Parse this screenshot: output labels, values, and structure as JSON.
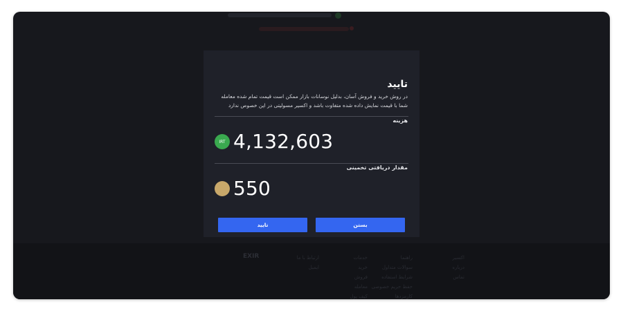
{
  "dialog": {
    "title": "تایید",
    "description": "در روش خرید و فروش آسان، بدلیل نوسانات بازار ممکن است قیمت تمام شده معامله شما با قیمت نمایش داده شده متفاوت باشد و اکسیر مسولیتی در این خصوص ندارد",
    "cost_label": "هزینه",
    "cost_currency": "IRT",
    "cost_value": "4,132,603",
    "receive_label": "مقدار دریافتی تخمینی",
    "receive_value": "550",
    "close_label": "بستن",
    "confirm_label": "تایید"
  },
  "colors": {
    "accent": "#3466f0",
    "irt_coin": "#3aa94f",
    "receive_coin": "#c8a86a",
    "dialog_bg": "#1f2129"
  },
  "footer": {
    "brand": "EXIR",
    "columns": [
      {
        "title": "اکسیر",
        "items": [
          "درباره",
          "تماس"
        ]
      },
      {
        "title": "راهنما",
        "items": [
          "سوالات متداول",
          "شرایط استفاده",
          "حفظ حریم خصوصی",
          "کارمزدها"
        ]
      },
      {
        "title": "خدمات",
        "items": [
          "خرید",
          "فروش",
          "معامله",
          "کیف پول"
        ]
      },
      {
        "title": "ارتباط با ما",
        "items": [
          "ایمیل"
        ]
      }
    ]
  }
}
